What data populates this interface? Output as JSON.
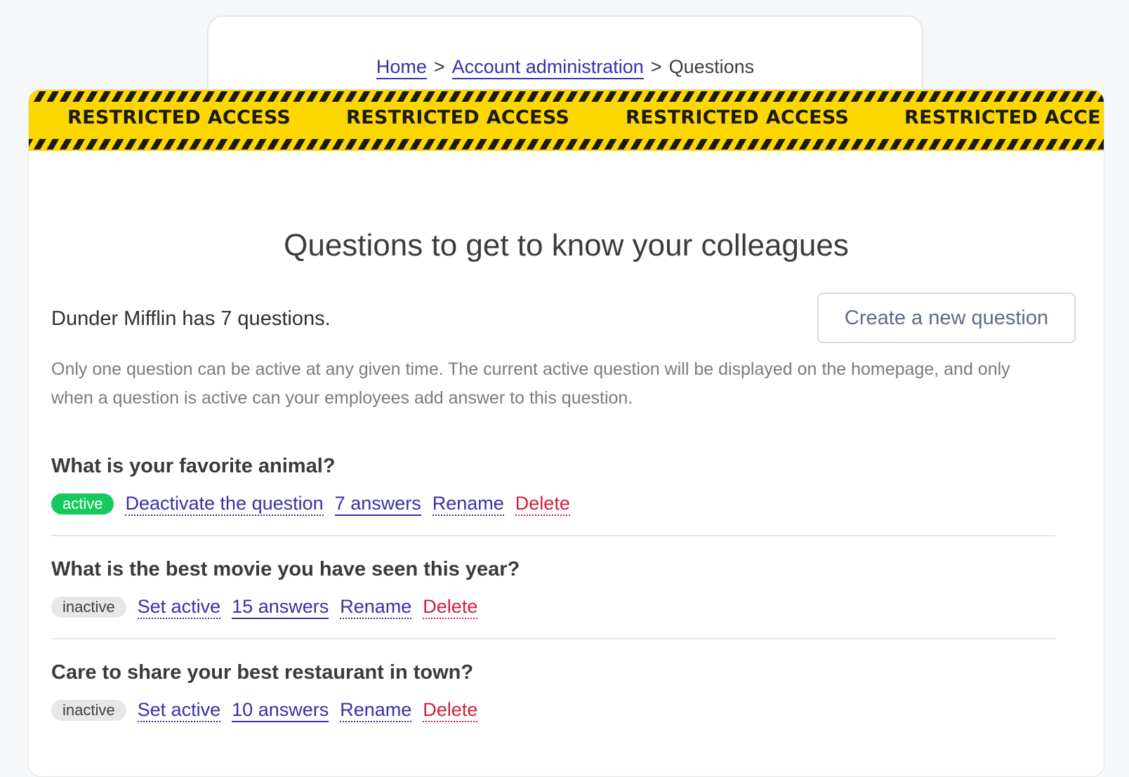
{
  "breadcrumb": {
    "home": "Home",
    "sep1": ">",
    "account_admin": "Account administration",
    "sep2": ">",
    "current": "Questions"
  },
  "banner": {
    "text": "RESTRICTED ACCESS",
    "text_partial": "RESTRICTED ACCE",
    "colors": {
      "background": "#fdd700",
      "stripe": "#1a1a1a"
    }
  },
  "page": {
    "title": "Questions to get to know your colleagues",
    "count_text": "Dunder Mifflin has 7 questions.",
    "create_button": "Create a new question",
    "info": "Only one question can be active at any given time. The current active question will be displayed on the homepage, and only when a question is active can your employees add answer to this question."
  },
  "questions": [
    {
      "title": "What is your favorite animal?",
      "status": "active",
      "toggle_label": "Deactivate the question",
      "answers_label": "7 answers",
      "rename_label": "Rename",
      "delete_label": "Delete"
    },
    {
      "title": "What is the best movie you have seen this year?",
      "status": "inactive",
      "toggle_label": "Set active",
      "answers_label": "15 answers",
      "rename_label": "Rename",
      "delete_label": "Delete"
    },
    {
      "title": "Care to share your best restaurant in town?",
      "status": "inactive",
      "toggle_label": "Set active",
      "answers_label": "10 answers",
      "rename_label": "Rename",
      "delete_label": "Delete"
    }
  ],
  "colors": {
    "link": "#3a2fa8",
    "danger": "#cf1f3f",
    "active_badge": "#14c95e",
    "inactive_badge": "#e6e7e9"
  }
}
